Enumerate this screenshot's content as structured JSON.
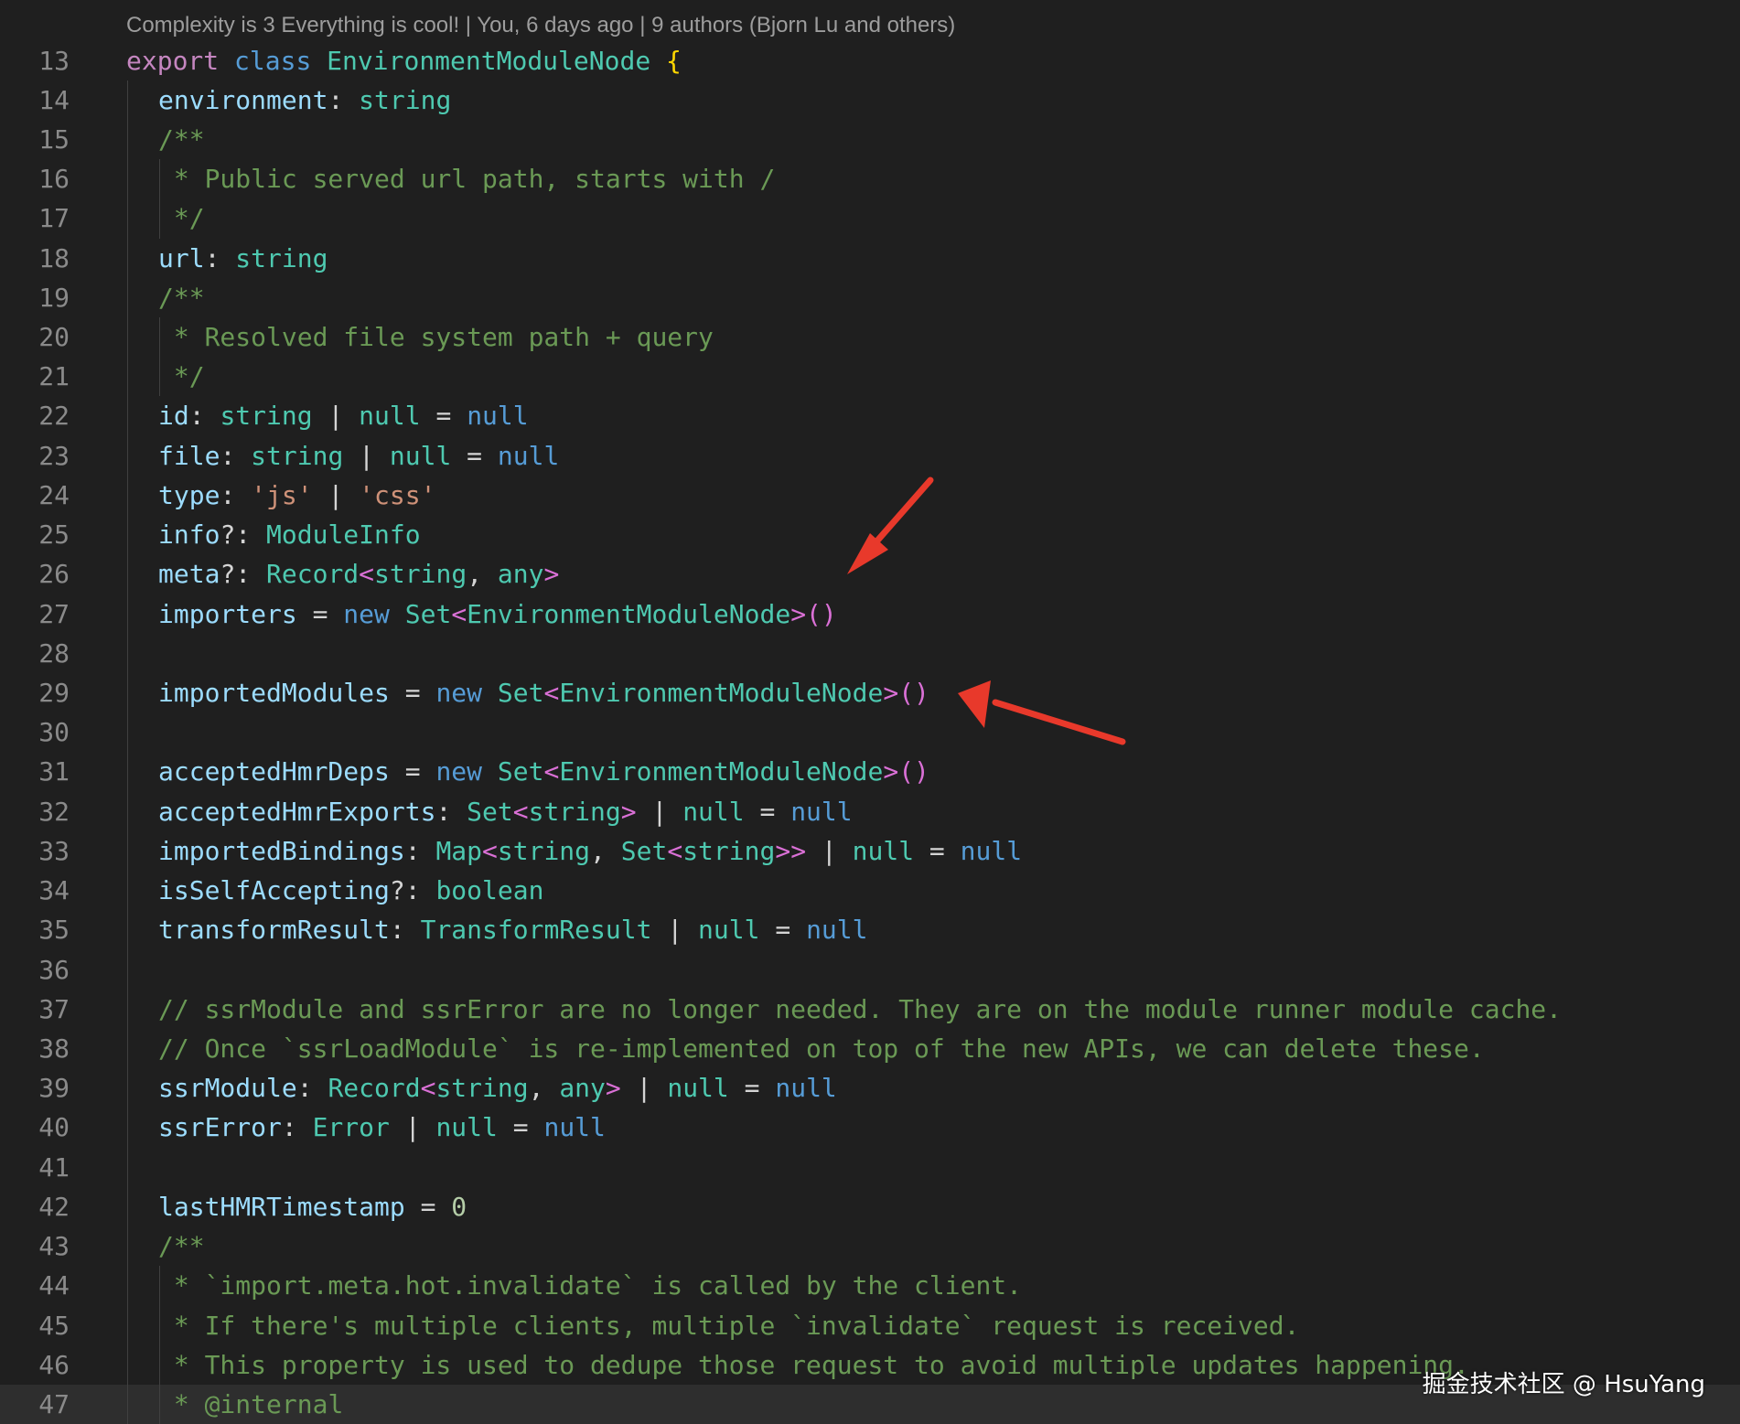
{
  "editor": {
    "codelens": "Complexity is 3 Everything is cool! | You, 6 days ago | 9 authors (Bjorn Lu and others)",
    "lines": [
      {
        "n": "13",
        "indent": 0,
        "tokens": [
          [
            "kw2",
            "export "
          ],
          [
            "kw",
            "class "
          ],
          [
            "type",
            "EnvironmentModuleNode "
          ],
          [
            "br1",
            "{"
          ]
        ]
      },
      {
        "n": "14",
        "indent": 1,
        "tokens": [
          [
            "prop",
            "environment"
          ],
          [
            "txt",
            ": "
          ],
          [
            "type",
            "string"
          ]
        ]
      },
      {
        "n": "15",
        "indent": 1,
        "tokens": [
          [
            "com",
            "/**"
          ]
        ]
      },
      {
        "n": "16",
        "indent": 2,
        "tokens": [
          [
            "com",
            " * Public served url path, starts with /"
          ]
        ]
      },
      {
        "n": "17",
        "indent": 2,
        "tokens": [
          [
            "com",
            " */"
          ]
        ]
      },
      {
        "n": "18",
        "indent": 1,
        "tokens": [
          [
            "prop",
            "url"
          ],
          [
            "txt",
            ": "
          ],
          [
            "type",
            "string"
          ]
        ]
      },
      {
        "n": "19",
        "indent": 1,
        "tokens": [
          [
            "com",
            "/**"
          ]
        ]
      },
      {
        "n": "20",
        "indent": 2,
        "tokens": [
          [
            "com",
            " * Resolved file system path + query"
          ]
        ]
      },
      {
        "n": "21",
        "indent": 2,
        "tokens": [
          [
            "com",
            " */"
          ]
        ]
      },
      {
        "n": "22",
        "indent": 1,
        "tokens": [
          [
            "prop",
            "id"
          ],
          [
            "txt",
            ": "
          ],
          [
            "type",
            "string"
          ],
          [
            "txt",
            " | "
          ],
          [
            "type",
            "null"
          ],
          [
            "txt",
            " = "
          ],
          [
            "kw",
            "null"
          ]
        ]
      },
      {
        "n": "23",
        "indent": 1,
        "tokens": [
          [
            "prop",
            "file"
          ],
          [
            "txt",
            ": "
          ],
          [
            "type",
            "string"
          ],
          [
            "txt",
            " | "
          ],
          [
            "type",
            "null"
          ],
          [
            "txt",
            " = "
          ],
          [
            "kw",
            "null"
          ]
        ]
      },
      {
        "n": "24",
        "indent": 1,
        "tokens": [
          [
            "prop",
            "type"
          ],
          [
            "txt",
            ": "
          ],
          [
            "str",
            "'js'"
          ],
          [
            "txt",
            " | "
          ],
          [
            "str",
            "'css'"
          ]
        ]
      },
      {
        "n": "25",
        "indent": 1,
        "tokens": [
          [
            "prop",
            "info"
          ],
          [
            "txt",
            "?: "
          ],
          [
            "type",
            "ModuleInfo"
          ]
        ]
      },
      {
        "n": "26",
        "indent": 1,
        "tokens": [
          [
            "prop",
            "meta"
          ],
          [
            "txt",
            "?: "
          ],
          [
            "type",
            "Record"
          ],
          [
            "br2",
            "<"
          ],
          [
            "type",
            "string"
          ],
          [
            "txt",
            ", "
          ],
          [
            "type",
            "any"
          ],
          [
            "br2",
            ">"
          ]
        ]
      },
      {
        "n": "27",
        "indent": 1,
        "tokens": [
          [
            "prop",
            "importers"
          ],
          [
            "txt",
            " = "
          ],
          [
            "kw",
            "new "
          ],
          [
            "type",
            "Set"
          ],
          [
            "br2",
            "<"
          ],
          [
            "type",
            "EnvironmentModuleNode"
          ],
          [
            "br2",
            ">()"
          ]
        ]
      },
      {
        "n": "28",
        "indent": 1,
        "tokens": []
      },
      {
        "n": "29",
        "indent": 1,
        "tokens": [
          [
            "prop",
            "importedModules"
          ],
          [
            "txt",
            " = "
          ],
          [
            "kw",
            "new "
          ],
          [
            "type",
            "Set"
          ],
          [
            "br2",
            "<"
          ],
          [
            "type",
            "EnvironmentModuleNode"
          ],
          [
            "br2",
            ">()"
          ]
        ]
      },
      {
        "n": "30",
        "indent": 1,
        "tokens": []
      },
      {
        "n": "31",
        "indent": 1,
        "tokens": [
          [
            "prop",
            "acceptedHmrDeps"
          ],
          [
            "txt",
            " = "
          ],
          [
            "kw",
            "new "
          ],
          [
            "type",
            "Set"
          ],
          [
            "br2",
            "<"
          ],
          [
            "type",
            "EnvironmentModuleNode"
          ],
          [
            "br2",
            ">()"
          ]
        ]
      },
      {
        "n": "32",
        "indent": 1,
        "tokens": [
          [
            "prop",
            "acceptedHmrExports"
          ],
          [
            "txt",
            ": "
          ],
          [
            "type",
            "Set"
          ],
          [
            "br2",
            "<"
          ],
          [
            "type",
            "string"
          ],
          [
            "br2",
            ">"
          ],
          [
            "txt",
            " | "
          ],
          [
            "type",
            "null"
          ],
          [
            "txt",
            " = "
          ],
          [
            "kw",
            "null"
          ]
        ]
      },
      {
        "n": "33",
        "indent": 1,
        "tokens": [
          [
            "prop",
            "importedBindings"
          ],
          [
            "txt",
            ": "
          ],
          [
            "type",
            "Map"
          ],
          [
            "br2",
            "<"
          ],
          [
            "type",
            "string"
          ],
          [
            "txt",
            ", "
          ],
          [
            "type",
            "Set"
          ],
          [
            "br2",
            "<"
          ],
          [
            "type",
            "string"
          ],
          [
            "br2",
            ">>"
          ],
          [
            "txt",
            " | "
          ],
          [
            "type",
            "null"
          ],
          [
            "txt",
            " = "
          ],
          [
            "kw",
            "null"
          ]
        ]
      },
      {
        "n": "34",
        "indent": 1,
        "tokens": [
          [
            "prop",
            "isSelfAccepting"
          ],
          [
            "txt",
            "?: "
          ],
          [
            "type",
            "boolean"
          ]
        ]
      },
      {
        "n": "35",
        "indent": 1,
        "tokens": [
          [
            "prop",
            "transformResult"
          ],
          [
            "txt",
            ": "
          ],
          [
            "type",
            "TransformResult"
          ],
          [
            "txt",
            " | "
          ],
          [
            "type",
            "null"
          ],
          [
            "txt",
            " = "
          ],
          [
            "kw",
            "null"
          ]
        ]
      },
      {
        "n": "36",
        "indent": 1,
        "tokens": []
      },
      {
        "n": "37",
        "indent": 1,
        "tokens": [
          [
            "com",
            "// ssrModule and ssrError are no longer needed. They are on the module runner module cache."
          ]
        ]
      },
      {
        "n": "38",
        "indent": 1,
        "tokens": [
          [
            "com",
            "// Once `ssrLoadModule` is re-implemented on top of the new APIs, we can delete these."
          ]
        ]
      },
      {
        "n": "39",
        "indent": 1,
        "tokens": [
          [
            "prop",
            "ssrModule"
          ],
          [
            "txt",
            ": "
          ],
          [
            "type",
            "Record"
          ],
          [
            "br2",
            "<"
          ],
          [
            "type",
            "string"
          ],
          [
            "txt",
            ", "
          ],
          [
            "type",
            "any"
          ],
          [
            "br2",
            ">"
          ],
          [
            "txt",
            " | "
          ],
          [
            "type",
            "null"
          ],
          [
            "txt",
            " = "
          ],
          [
            "kw",
            "null"
          ]
        ]
      },
      {
        "n": "40",
        "indent": 1,
        "tokens": [
          [
            "prop",
            "ssrError"
          ],
          [
            "txt",
            ": "
          ],
          [
            "type",
            "Error"
          ],
          [
            "txt",
            " | "
          ],
          [
            "type",
            "null"
          ],
          [
            "txt",
            " = "
          ],
          [
            "kw",
            "null"
          ]
        ]
      },
      {
        "n": "41",
        "indent": 1,
        "tokens": []
      },
      {
        "n": "42",
        "indent": 1,
        "tokens": [
          [
            "prop",
            "lastHMRTimestamp"
          ],
          [
            "txt",
            " = "
          ],
          [
            "num",
            "0"
          ]
        ]
      },
      {
        "n": "43",
        "indent": 1,
        "tokens": [
          [
            "com",
            "/**"
          ]
        ]
      },
      {
        "n": "44",
        "indent": 2,
        "tokens": [
          [
            "com",
            " * `import.meta.hot.invalidate` is called by the client."
          ]
        ]
      },
      {
        "n": "45",
        "indent": 2,
        "tokens": [
          [
            "com",
            " * If there's multiple clients, multiple `invalidate` request is received."
          ]
        ]
      },
      {
        "n": "46",
        "indent": 2,
        "tokens": [
          [
            "com",
            " * This property is used to dedupe those request to avoid multiple updates happening."
          ]
        ]
      },
      {
        "n": "47",
        "indent": 2,
        "current": true,
        "tokens": [
          [
            "com",
            " * "
          ],
          [
            "com",
            "@internal"
          ]
        ]
      }
    ]
  },
  "annotation": {
    "color": "#e8392b"
  },
  "watermark": "掘金技术社区 @ HsuYang"
}
